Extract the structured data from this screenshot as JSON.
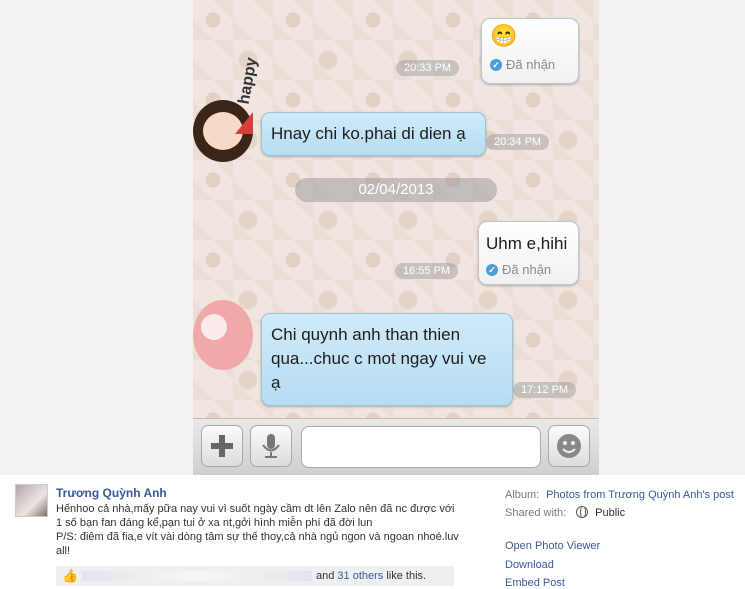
{
  "chat": {
    "messages": [
      {
        "side": "me",
        "text": "😁",
        "time": "20:33 PM",
        "status": "Đã nhận"
      },
      {
        "side": "them",
        "text": "Hnay chi ko.phai di dien ạ",
        "time": "20:34 PM",
        "sticker": "happy"
      },
      {
        "side": "me",
        "text": "Uhm e,hihi",
        "time": "16:55 PM",
        "status": "Đã nhận"
      },
      {
        "side": "them",
        "text_lines": [
          "Chi quynh anh than thien",
          "qua...chuc c mot ngay vui ve",
          "ạ"
        ],
        "time": "17:12 PM"
      }
    ],
    "date_separator": "02/04/2013",
    "sticker_text": "happy",
    "toolbar": {
      "add_icon": "plus-icon",
      "mic_icon": "microphone-icon",
      "emoji_icon": "emoji-icon"
    }
  },
  "post": {
    "author": "Trương Quỳnh Anh",
    "caption_lines": [
      "Hếnhoo cả nhà,mấy pữa nay vui vì suốt ngày cầm dt lên Zalo nên đã nc được với",
      "1 số bạn fan đáng kể,pạn tui ở xa nt,gởi hình miễn phí đã đời lun",
      "P/S: điêm đã fia,e vít vài dòng tâm sự thế thoy,cả nhà ngủ ngon và ngoan nhoé.luv",
      "all!"
    ],
    "likes": {
      "and": "and",
      "others_link": "31 others",
      "suffix": "like this."
    },
    "meta": {
      "album_label": "Album:",
      "album_value": "Photos from Trương Quỳnh Anh's post",
      "shared_label": "Shared with:",
      "shared_value": "Public"
    },
    "actions": [
      "Open Photo Viewer",
      "Download",
      "Embed Post"
    ]
  },
  "colors": {
    "link": "#3b5998",
    "bubble_blue": "#bfe0f4",
    "check": "#4b9ed6"
  }
}
